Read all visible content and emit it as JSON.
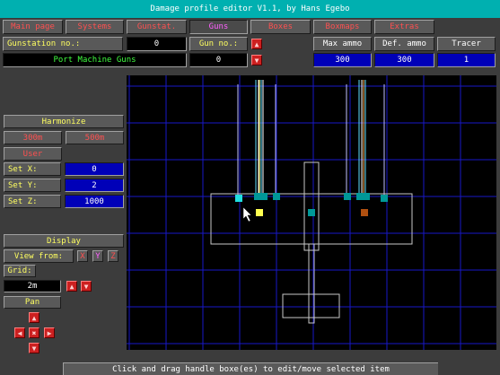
{
  "title": "Damage profile editor V1.1, by Hans Egebo",
  "menu": [
    "Main page",
    "Systems",
    "Gunstat.",
    "Guns",
    "Boxes",
    "Boxmaps",
    "Extras"
  ],
  "gunstation": {
    "label": "Gunstation no.:",
    "value": "0",
    "gun_label": "Gun no.:",
    "gun_value": "0",
    "name": "Port Machine Guns"
  },
  "ammo": {
    "max_label": "Max ammo",
    "def_label": "Def. ammo",
    "tracer_label": "Tracer",
    "max_value": "300",
    "def_value": "300",
    "tracer_value": "1"
  },
  "harmonize": {
    "title": "Harmonize",
    "opt1": "300m",
    "opt2": "500m",
    "user": "User"
  },
  "coords": {
    "x_label": "Set X:",
    "x_value": "0",
    "y_label": "Set Y:",
    "y_value": "2",
    "z_label": "Set Z:",
    "z_value": "1000"
  },
  "display": {
    "title": "Display",
    "view_from": "View from:",
    "axes": [
      "X",
      "Y",
      "Z"
    ],
    "grid_label": "Grid:",
    "grid_value": "2m",
    "pan": "Pan"
  },
  "status": "Click and drag handle boxe(es) to edit/move selected item",
  "colors": {
    "accent_red": "#ff5050",
    "title_bar": "#00b0b0",
    "value_blue": "#0000b8",
    "grid_blue": "#1818c8"
  }
}
